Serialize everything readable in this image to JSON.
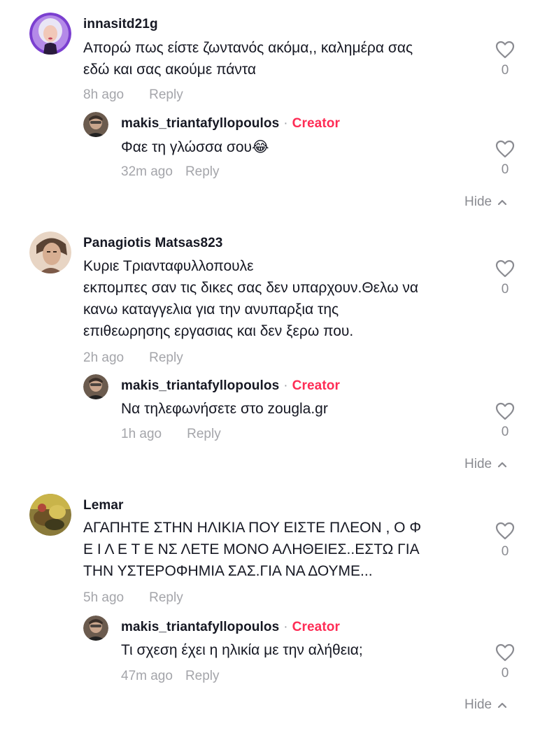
{
  "threads": [
    {
      "comment": {
        "username": "innasitd21g",
        "text": "Απορώ πως είστε ζωντανός ακόμα,, καλημέρα σας\nεδώ και σας ακούμε πάντα",
        "time": "8h ago",
        "reply_label": "Reply",
        "likes": "0"
      },
      "reply": {
        "username": "makis_triantafyllopoulos",
        "separator": "·",
        "badge": "Creator",
        "text": "Φαε τη γλώσσα σου😂",
        "time": "32m ago",
        "reply_label": "Reply",
        "likes": "0"
      },
      "hide_label": "Hide"
    },
    {
      "comment": {
        "username": "Panagiotis Matsas823",
        "text": "Κυριε Τριανταφυλλοπουλε\nεκπομπες σαν τις δικες σας δεν υπαρχουν.Θελω να\nκανω καταγγελια για την ανυπαρξια της\nεπιθεωρησης εργασιας και δεν ξερω που.",
        "time": "2h ago",
        "reply_label": "Reply",
        "likes": "0"
      },
      "reply": {
        "username": "makis_triantafyllopoulos",
        "separator": "·",
        "badge": "Creator",
        "text": "Να τηλεφωνήσετε στο zougla.gr",
        "time": "1h ago",
        "reply_label": "Reply",
        "likes": "0"
      },
      "hide_label": "Hide"
    },
    {
      "comment": {
        "username": "Lemar",
        "text": "ΑΓΑΠΗΤΕ ΣΤΗΝ ΗΛΙΚΙΑ ΠΟΥ ΕΙΣΤΕ ΠΛΕΟΝ , Ο Φ\nΕ Ι Λ Ε Τ Ε ΝΣ ΛΕΤΕ ΜΟΝΟ ΑΛΗΘΕΙΕΣ..ΕΣΤΩ ΓΙΑ\nΤΗΝ ΥΣΤΕΡΟΦΗΜΙΑ ΣΑΣ.ΓΙΑ ΝΑ ΔΟΥΜΕ...",
        "time": "5h ago",
        "reply_label": "Reply",
        "likes": "0"
      },
      "reply": {
        "username": "makis_triantafyllopoulos",
        "separator": "·",
        "badge": "Creator",
        "text": "Τι σχεση έχει η ηλικία με την αλήθεια;",
        "time": "47m ago",
        "reply_label": "Reply",
        "likes": "0"
      },
      "hide_label": "Hide"
    }
  ],
  "icons": {
    "like": "heart-outline-icon",
    "hide": "chevron-up-icon"
  },
  "colors": {
    "creator_badge": "#fe2c55",
    "secondary_text": "#a4a5aa",
    "primary_text": "#161823"
  }
}
